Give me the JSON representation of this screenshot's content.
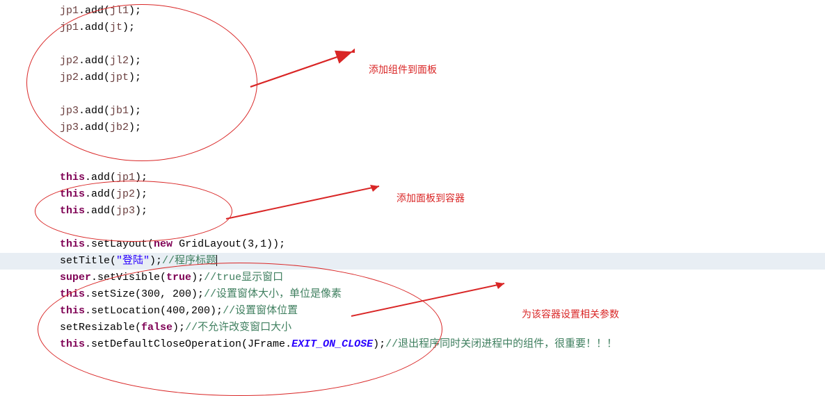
{
  "code": {
    "l1_a": "jp1",
    "l1_b": ".add(",
    "l1_c": "jl1",
    "l1_d": ");",
    "l2_a": "jp1",
    "l2_b": ".add(",
    "l2_c": "jt",
    "l2_d": ");",
    "l3_a": "jp2",
    "l3_b": ".add(",
    "l3_c": "jl2",
    "l3_d": ");",
    "l4_a": "jp2",
    "l4_b": ".add(",
    "l4_c": "jpt",
    "l4_d": ");",
    "l5_a": "jp3",
    "l5_b": ".add(",
    "l5_c": "jb1",
    "l5_d": ");",
    "l6_a": "jp3",
    "l6_b": ".add(",
    "l6_c": "jb2",
    "l6_d": ");",
    "l7_a": "this",
    "l7_b": ".add(",
    "l7_c": "jp1",
    "l7_d": ");",
    "l8_a": "this",
    "l8_b": ".add(",
    "l8_c": "jp2",
    "l8_d": ");",
    "l9_a": "this",
    "l9_b": ".add(",
    "l9_c": "jp3",
    "l9_d": ");",
    "l10_a": "this",
    "l10_b": ".setLayout(",
    "l10_c": "new",
    "l10_d": " GridLayout(3,1));",
    "l11_a": "setTitle(",
    "l11_b": "\"登陆\"",
    "l11_c": ");",
    "l11_d": "//程序标题",
    "l12_a": "super",
    "l12_b": ".setVisible(",
    "l12_c": "true",
    "l12_d": ");",
    "l12_e": "//true显示窗口",
    "l13_a": "this",
    "l13_b": ".setSize(300, 200);",
    "l13_c": "//设置窗体大小，单位是像素",
    "l14_a": "this",
    "l14_b": ".setLocation(400,200);",
    "l14_c": "//设置窗体位置",
    "l15_a": "setResizable(",
    "l15_b": "false",
    "l15_c": ");",
    "l15_d": "//不允许改变窗口大小",
    "l16_a": "this",
    "l16_b": ".setDefaultCloseOperation(JFrame.",
    "l16_c": "EXIT_ON_CLOSE",
    "l16_d": ");",
    "l16_e": "//退出程序同时关闭进程中的组件，很重要！！！"
  },
  "annotations": {
    "a1": "添加组件到面板",
    "a2": "添加面板到容器",
    "a3": "为该容器设置相关参数"
  }
}
